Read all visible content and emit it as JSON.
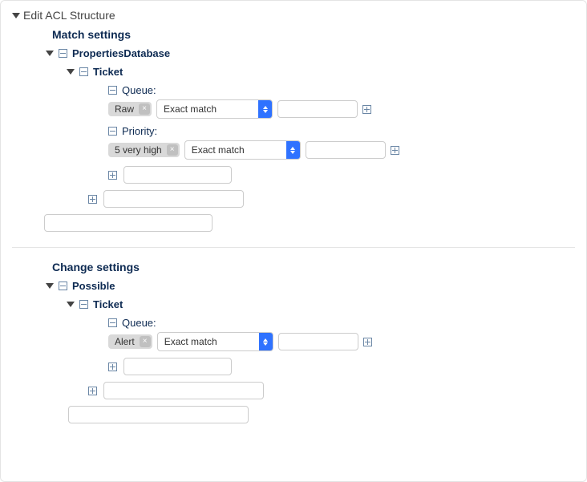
{
  "panel": {
    "title": "Edit ACL Structure"
  },
  "match": {
    "heading": "Match settings",
    "root": {
      "label": "PropertiesDatabase"
    },
    "ticket": {
      "label": "Ticket",
      "queue": {
        "label": "Queue:",
        "chip": "Raw",
        "match_type": "Exact match"
      },
      "priority": {
        "label": "Priority:",
        "chip": "5 very high",
        "match_type": "Exact match"
      }
    }
  },
  "change": {
    "heading": "Change settings",
    "root": {
      "label": "Possible"
    },
    "ticket": {
      "label": "Ticket",
      "queue": {
        "label": "Queue:",
        "chip": "Alert",
        "match_type": "Exact match"
      }
    }
  }
}
